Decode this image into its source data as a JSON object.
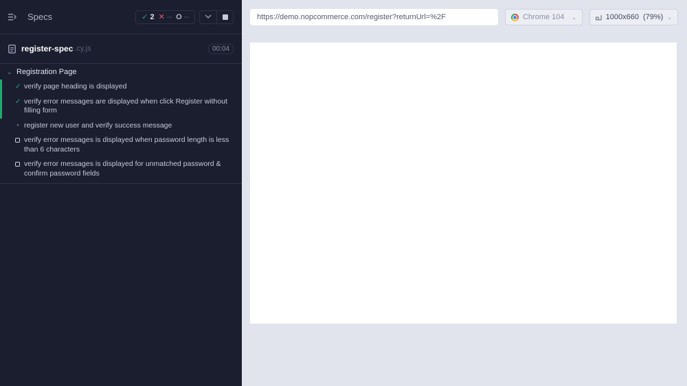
{
  "sidebar": {
    "specs_label": "Specs",
    "stats": {
      "passed": "2",
      "failed": "--",
      "pending": "--"
    },
    "spec": {
      "name": "register-spec",
      "ext": ".cy.js",
      "duration": "00:04"
    },
    "suite": {
      "title": "Registration Page",
      "tests": [
        {
          "status": "passed",
          "title": "verify page heading is displayed"
        },
        {
          "status": "passed",
          "title": "verify error messages are displayed when click Register without filling form"
        },
        {
          "status": "running",
          "title": "register new user and verify success message"
        },
        {
          "status": "queued",
          "title": "verify error messages is displayed when password length is less than 6 characters"
        },
        {
          "status": "queued",
          "title": "verify error messages is displayed for unmatched password & confirm password fields"
        }
      ]
    }
  },
  "aut": {
    "url": "https://demo.nopcommerce.com/register?returnUrl=%2F",
    "browser": "Chrome 104",
    "viewport": "1000x660",
    "zoom": "(79%)"
  },
  "colors": {
    "passed": "#1fa971",
    "failed": "#e45770",
    "sidebar_bg": "#1b1e2e",
    "aut_bg": "#e1e3ed"
  },
  "icons": [
    "specs-toggle-icon",
    "checkmark-icon",
    "x-icon",
    "spinner-icon",
    "chevron-down-icon",
    "stop-icon",
    "file-icon",
    "chrome-icon",
    "viewport-icon"
  ]
}
